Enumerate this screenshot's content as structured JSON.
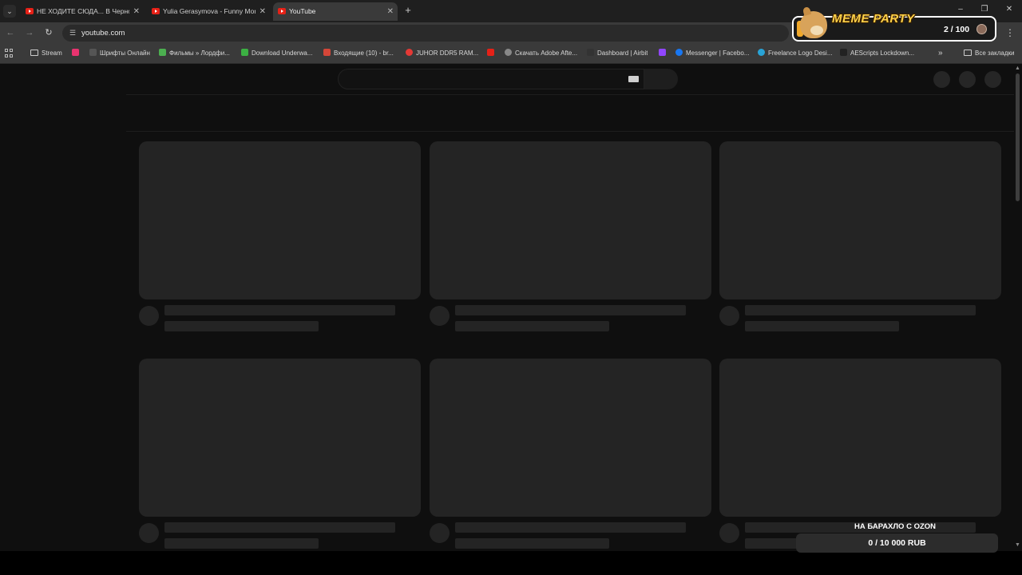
{
  "browser": {
    "tabs": [
      {
        "title": "НЕ ХОДИТЕ СЮДА... В Черноб",
        "active": false
      },
      {
        "title": "Yulia Gerasymova - Funny Mon",
        "active": false
      },
      {
        "title": "YouTube",
        "active": true
      }
    ],
    "new_tab_label": "+",
    "address": "youtube.com",
    "bookmarks": [
      {
        "label": "Stream",
        "icon": "folder-icon"
      },
      {
        "label": "",
        "icon": "pink-favicon"
      },
      {
        "label": "Шрифты Онлайн",
        "icon": "fonts-favicon"
      },
      {
        "label": "Фильмы » Лордфи...",
        "icon": "green-hd-favicon"
      },
      {
        "label": "Download Underwa...",
        "icon": "green-ae-favicon"
      },
      {
        "label": "Входящие (10) - br...",
        "icon": "gmail-favicon"
      },
      {
        "label": "JUHOR DDR5 RAM...",
        "icon": "red-favicon"
      },
      {
        "label": "",
        "icon": "youtube-favicon"
      },
      {
        "label": "Скачать Adobe Afte...",
        "icon": "globe-favicon"
      },
      {
        "label": "Dashboard | Airbit",
        "icon": "dark-favicon"
      },
      {
        "label": "",
        "icon": "twitch-favicon"
      },
      {
        "label": "Messenger | Facebo...",
        "icon": "facebook-favicon"
      },
      {
        "label": "Freelance Logo Desi...",
        "icon": "blue-favicon"
      },
      {
        "label": "AEScripts Lockdown...",
        "icon": "aescripts-favicon"
      }
    ],
    "overflow_label": "»",
    "all_bookmarks": "Все закладки"
  },
  "overlays": {
    "meme_title": "MEME PARTY",
    "meme_count": "2 / 100",
    "ozon_title": "НА БАРАХЛО С OZON",
    "ozon_progress": "0 / 10 000 RUB",
    "ozon_fraction": 0
  },
  "colors": {
    "page_bg": "#0f0f0f",
    "skeleton": "#242424",
    "chrome_bar": "#3a3a3a",
    "meme_title": "#ffd24a"
  }
}
